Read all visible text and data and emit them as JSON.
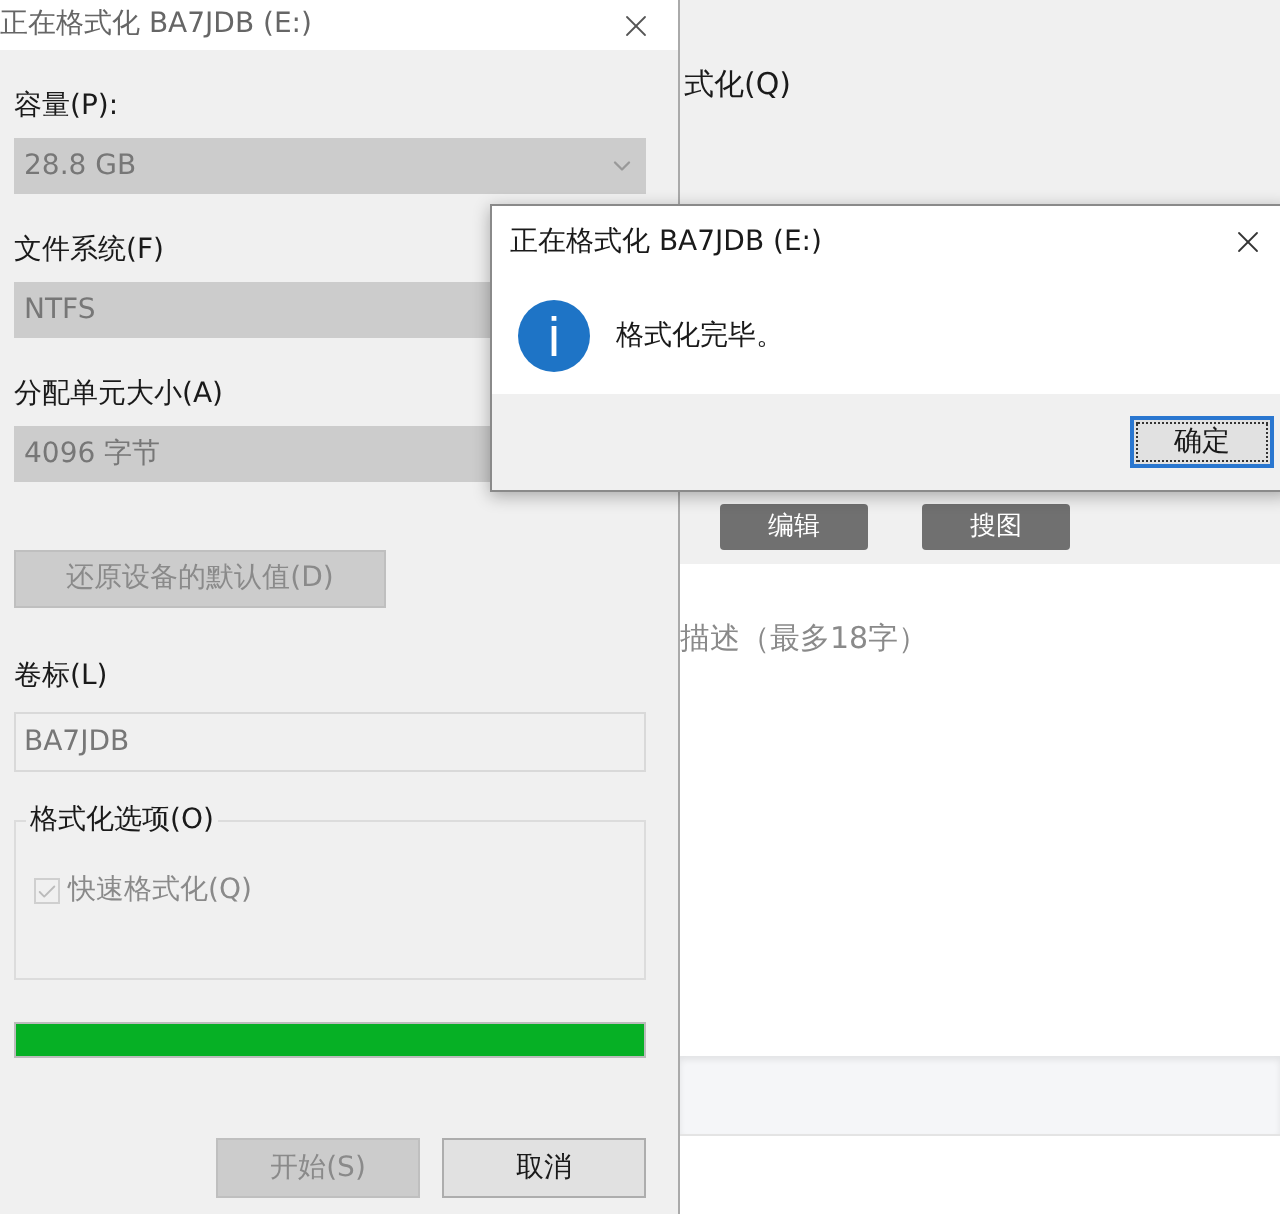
{
  "background_app": {
    "option": "式化(Q)",
    "buttons": [
      "编辑",
      "搜图"
    ],
    "description": {
      "placeholder": "描述（最多18字）"
    }
  },
  "format_dialog": {
    "title": "正在格式化 BA7JDB (E:)",
    "fields": [
      {
        "kind": "dropdown",
        "label": "容量(P):",
        "value": "28.8 GB"
      },
      {
        "kind": "readonly",
        "label": "文件系统(F)",
        "value": "NTFS"
      },
      {
        "kind": "readonly",
        "label": "分配单元大小(A)",
        "value": "4096 字节"
      }
    ],
    "restore_button": {
      "label": "还原设备的默认值(D)",
      "disabled": true
    },
    "volume_label": {
      "label": "卷标(L)",
      "value": "BA7JDB"
    },
    "options": {
      "title": "格式化选项(O)",
      "quick_format": {
        "label": "快速格式化(Q)",
        "checked": true,
        "disabled": true
      }
    },
    "progress": {
      "level": 1
    },
    "buttons": [
      {
        "label": "开始(S)",
        "disabled": true
      },
      {
        "label": "取消",
        "disabled": false
      }
    ]
  },
  "message_box": {
    "title": "正在格式化 BA7JDB (E:)",
    "message": "格式化完毕。",
    "button": {
      "label": "确定",
      "default": true
    }
  }
}
